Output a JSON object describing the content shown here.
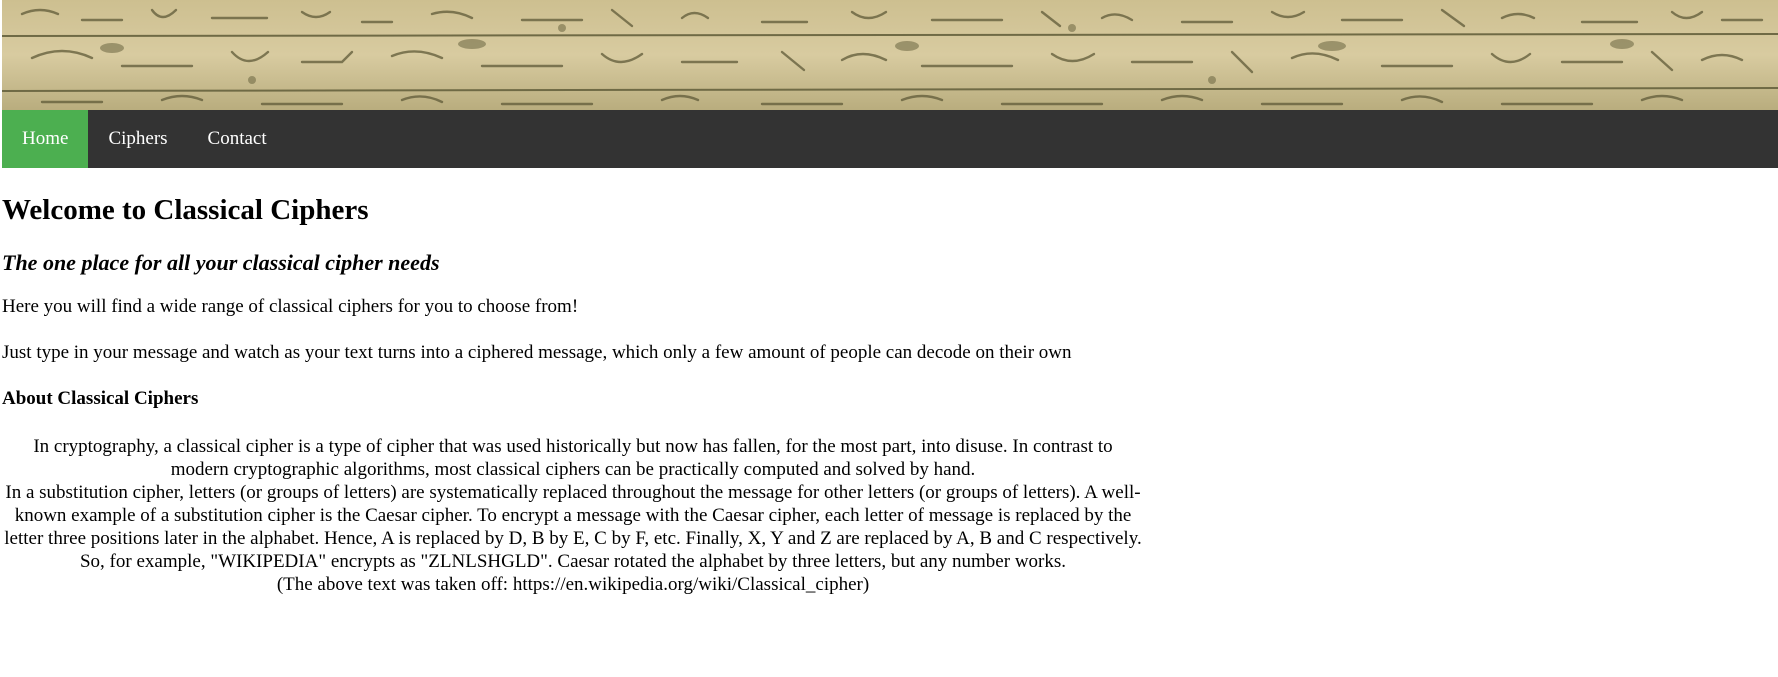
{
  "nav": {
    "items": [
      {
        "label": "Home",
        "active": true
      },
      {
        "label": "Ciphers",
        "active": false
      },
      {
        "label": "Contact",
        "active": false
      }
    ]
  },
  "main": {
    "title": "Welcome to Classical Ciphers",
    "tagline": "The one place for all your classical cipher needs",
    "intro": "Here you will find a wide range of classical ciphers for you to choose from!",
    "instruction": "Just type in your message and watch as your text turns into a ciphered message, which only a few amount of people can decode on their own",
    "about_heading": "About Classical Ciphers",
    "about_para1": "In cryptography, a classical cipher is a type of cipher that was used historically but now has fallen, for the most part, into disuse. In contrast to modern cryptographic algorithms, most classical ciphers can be practically computed and solved by hand.",
    "about_para2": "In a substitution cipher, letters (or groups of letters) are systematically replaced throughout the message for other letters (or groups of letters). A well-known example of a substitution cipher is the Caesar cipher. To encrypt a message with the Caesar cipher, each letter of message is replaced by the letter three positions later in the alphabet. Hence, A is replaced by D, B by E, C by F, etc. Finally, X, Y and Z are replaced by A, B and C respectively. So, for example, \"WIKIPEDIA\" encrypts as \"ZLNLSHGLD\". Caesar rotated the alphabet by three letters, but any number works.",
    "about_source": "(The above text was taken off: https://en.wikipedia.org/wiki/Classical_cipher)"
  },
  "colors": {
    "nav_background": "#333333",
    "nav_active": "#4caf50",
    "nav_text": "#ffffff"
  },
  "banner": {
    "icon": "hieroglyph-relief-banner"
  }
}
